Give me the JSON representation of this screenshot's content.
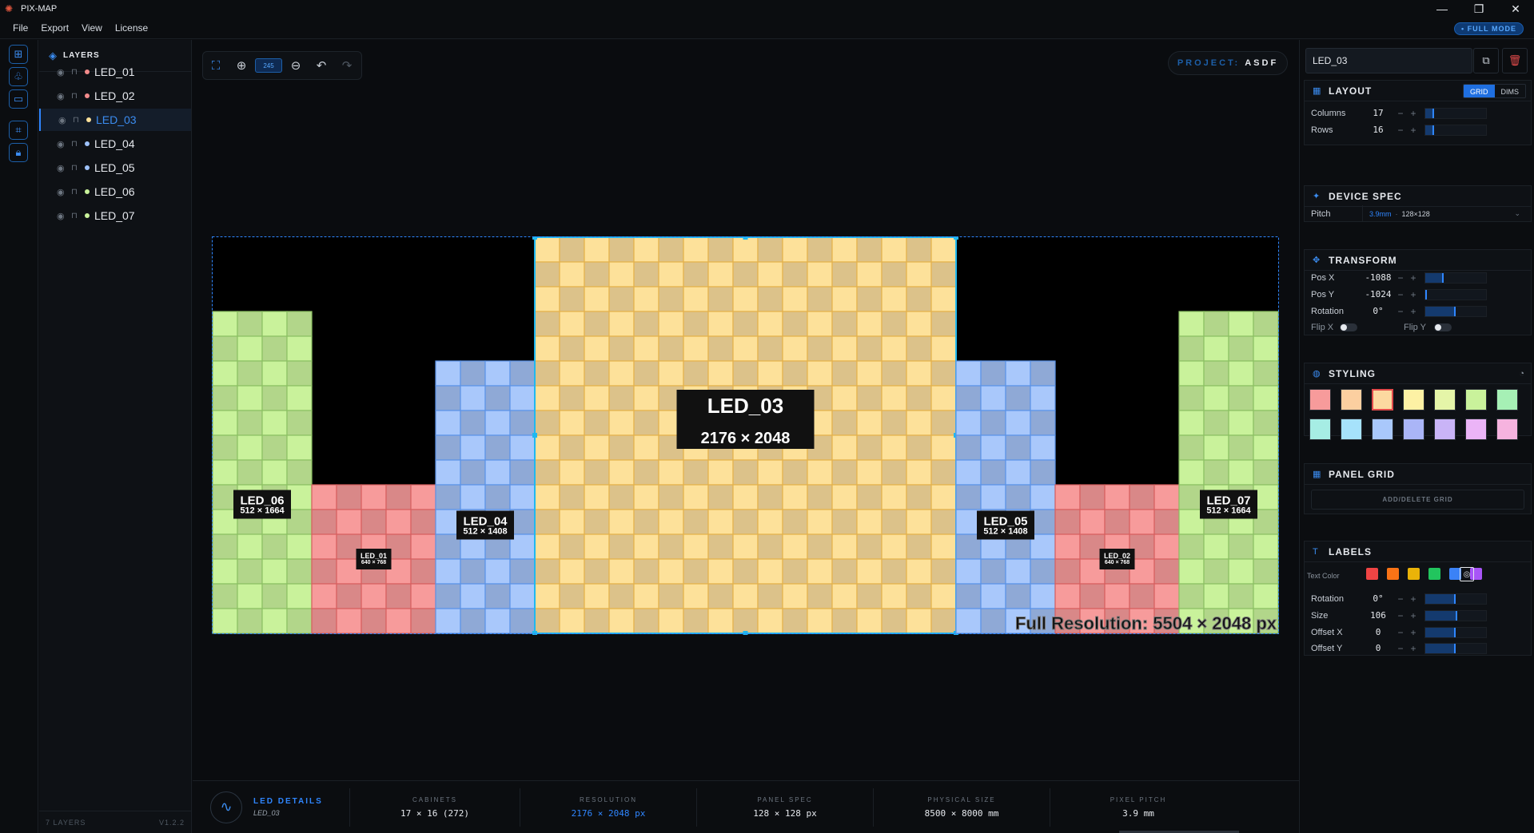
{
  "app": {
    "title": "PIX-MAP",
    "window_buttons": [
      "—",
      "❐",
      "✕"
    ]
  },
  "menu": {
    "items": [
      "File",
      "Export",
      "View",
      "License"
    ],
    "full_mode": "• FULL MODE"
  },
  "left_tools": {
    "icons": [
      "add-layer-icon",
      "shapes-icon",
      "folder-icon",
      "crop-icon",
      "lock-icon"
    ]
  },
  "layers_panel": {
    "title": "LAYERS",
    "layers": [
      {
        "name": "LED_01",
        "color": "#f28b8b"
      },
      {
        "name": "LED_02",
        "color": "#f28b8b"
      },
      {
        "name": "LED_03",
        "color": "#fde19a"
      },
      {
        "name": "LED_04",
        "color": "#9ec2fa"
      },
      {
        "name": "LED_05",
        "color": "#9ec2fa"
      },
      {
        "name": "LED_06",
        "color": "#c9f29b"
      },
      {
        "name": "LED_07",
        "color": "#c9f29b"
      }
    ],
    "selected": "LED_03",
    "count_label": "7 LAYERS",
    "version": "V1.2.2"
  },
  "view_toolbar": {
    "zoom_label": "245"
  },
  "project": {
    "key": "PROJECT:",
    "value": "ASDF"
  },
  "canvas": {
    "full_resolution_label": "Full Resolution: 5504 × 2048 px",
    "screens": [
      {
        "name": "LED_06",
        "dims": "512 × 1664",
        "cols": 4,
        "rows": 13,
        "colors": [
          "#c9f29b",
          "#b2d68a"
        ],
        "grid": "#8cc063"
      },
      {
        "name": "LED_01",
        "dims": "640 × 768",
        "cols": 5,
        "rows": 6,
        "colors": [
          "#f79b9b",
          "#d98888"
        ],
        "grid": "#d85f5f"
      },
      {
        "name": "LED_04",
        "dims": "512 × 1408",
        "cols": 4,
        "rows": 11,
        "colors": [
          "#a9c8fb",
          "#8fa9d6"
        ],
        "grid": "#5b93e8"
      },
      {
        "name": "LED_03",
        "dims": "2176 × 2048",
        "cols": 17,
        "rows": 16,
        "colors": [
          "#fde19a",
          "#dcc28a"
        ],
        "grid": "#e5b24a"
      },
      {
        "name": "LED_05",
        "dims": "512 × 1408",
        "cols": 4,
        "rows": 11,
        "colors": [
          "#a9c8fb",
          "#8fa9d6"
        ],
        "grid": "#5b93e8"
      },
      {
        "name": "LED_02",
        "dims": "640 × 768",
        "cols": 5,
        "rows": 6,
        "colors": [
          "#f79b9b",
          "#d98888"
        ],
        "grid": "#d85f5f"
      },
      {
        "name": "LED_07",
        "dims": "512 × 1664",
        "cols": 4,
        "rows": 13,
        "colors": [
          "#c9f29b",
          "#b2d68a"
        ],
        "grid": "#8cc063"
      }
    ]
  },
  "details": {
    "title": "LED DETAILS",
    "subtitle": "LED_03",
    "stats": [
      {
        "label": "CABINETS",
        "value": "17 × 16 (272)"
      },
      {
        "label": "RESOLUTION",
        "value": "2176 × 2048 px"
      },
      {
        "label": "PANEL SPEC",
        "value": "128 × 128 px"
      },
      {
        "label": "PHYSICAL SIZE",
        "value": "8500 × 8000 mm"
      },
      {
        "label": "PIXEL PITCH",
        "value": "3.9 mm"
      }
    ]
  },
  "right_panel": {
    "name_value": "LED_03",
    "layout": {
      "title": "LAYOUT",
      "mode_grid": "GRID",
      "mode_dims": "DIMS",
      "columns_label": "Columns",
      "columns_value": "17",
      "columns_level": 0.15,
      "rows_label": "Rows",
      "rows_value": "16",
      "rows_level": 0.14
    },
    "device_spec": {
      "title": "DEVICE SPEC",
      "pitch_label": "Pitch",
      "pitch_value": "3.9mm",
      "pitch_sep": "·",
      "pitch_res": "128×128"
    },
    "transform": {
      "title": "TRANSFORM",
      "posx_label": "Pos X",
      "posx_value": "-1088",
      "posx_level": 0.3,
      "posy_label": "Pos Y",
      "posy_value": "-1024",
      "posy_level": 0.02,
      "rotation_label": "Rotation",
      "rotation_value": "0°",
      "rotation_level": 0.5,
      "flipx_label": "Flip X",
      "flipy_label": "Flip Y"
    },
    "styling": {
      "title": "STYLING",
      "swatches": [
        "#f79b9b",
        "#fccfa0",
        "#fcd9a0",
        "#fdf1a4",
        "#e5f5a8",
        "#c9f29b",
        "#a6f0b5",
        "#a6ede4",
        "#a6e2fb",
        "#a9c8fb",
        "#aab5f7",
        "#c9b4f7",
        "#ebb4f7",
        "#f6b3df"
      ]
    },
    "panel_grid": {
      "title": "PANEL GRID",
      "button": "ADD/DELETE GRID"
    },
    "labels": {
      "title": "LABELS",
      "text_color_label": "Text Color",
      "text_colors": [
        "#ef4444",
        "#f97316",
        "#eab308",
        "#22c55e",
        "#3b82f6",
        "#a855f7"
      ],
      "rotation_label": "Rotation",
      "rotation_value": "0°",
      "rotation_level": 0.5,
      "size_label": "Size",
      "size_value": "106",
      "size_level": 0.52,
      "offsetx_label": "Offset X",
      "offsetx_value": "0",
      "offsetx_level": 0.5,
      "offsety_label": "Offset Y",
      "offsety_value": "0",
      "offsety_level": 0.5
    }
  }
}
